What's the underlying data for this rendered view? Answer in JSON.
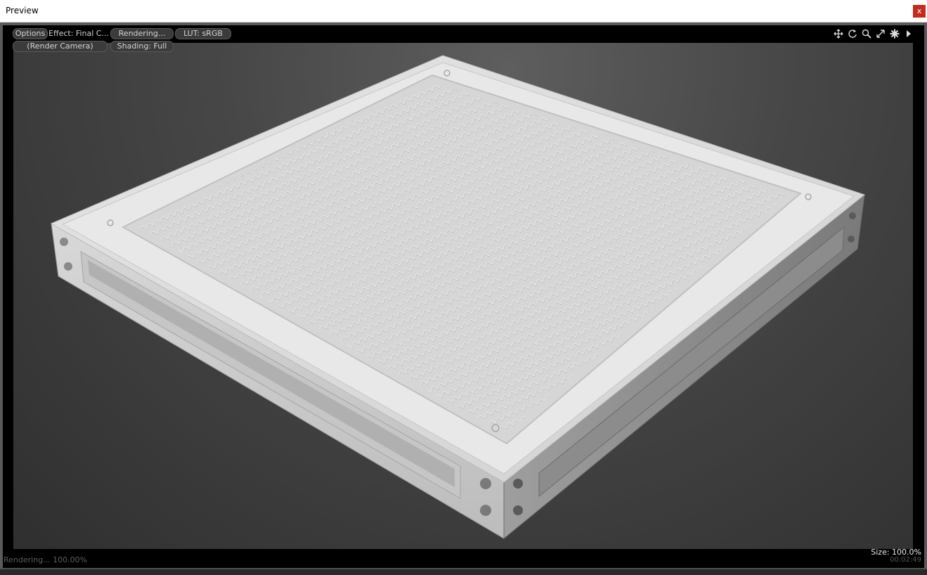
{
  "window": {
    "title": "Preview",
    "close_label": "x"
  },
  "toolbar": {
    "options": "Options",
    "effect": "Effect: Final C...",
    "rendering": "Rendering...",
    "lut": "LUT: sRGB",
    "camera": "(Render Camera)",
    "shading": "Shading: Full"
  },
  "tools": [
    "move-icon",
    "rotate-icon",
    "zoom-icon",
    "fit-icon",
    "gear-icon",
    "play-icon"
  ],
  "status": {
    "progress_text": "Rendering... 100.00%",
    "size_text": "Size: 100.0%",
    "time_text": "00:02:49"
  },
  "render": {
    "progress": 1.0,
    "zoom": 1.0
  }
}
